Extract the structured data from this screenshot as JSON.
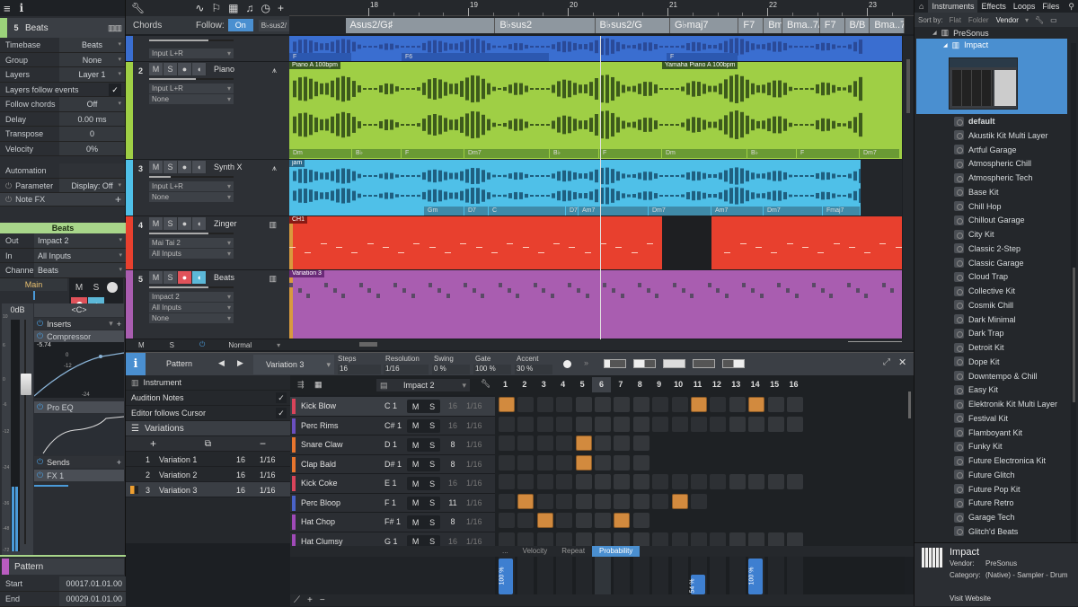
{
  "toolbar": {
    "menu_icon": "hamburger-icon",
    "info_icon": "info-icon",
    "tools": [
      "wrench-icon",
      "automation-icon",
      "marker-icon",
      "grid-icon",
      "note-icon",
      "clock-icon",
      "plus-icon"
    ]
  },
  "inspector": {
    "track_number": "5",
    "track_name": "Beats",
    "params": [
      {
        "label": "Timebase",
        "value": "Beats",
        "dropdown": true
      },
      {
        "label": "Group",
        "value": "None",
        "dropdown": true
      },
      {
        "label": "Layers",
        "value": "Layer 1",
        "dropdown": true
      }
    ],
    "layers_follow_events": {
      "label": "Layers follow events",
      "checked": true
    },
    "params2": [
      {
        "label": "Follow chords",
        "value": "Off",
        "dropdown": true
      },
      {
        "label": "Delay",
        "value": "0.00 ms"
      },
      {
        "label": "Transpose",
        "value": "0"
      },
      {
        "label": "Velocity",
        "value": "0%"
      }
    ],
    "automation_label": "Automation",
    "parameter_label": "Parameter",
    "display_value": "Display: Off",
    "note_fx_label": "Note FX",
    "channel_name": "Beats",
    "routing": [
      {
        "label": "Out",
        "value": "Impact 2"
      },
      {
        "label": "In",
        "value": "All Inputs"
      },
      {
        "label": "Channel",
        "value": "Beats"
      }
    ],
    "main_label": "Main",
    "volume_label": "0dB",
    "pan_label": "<C>",
    "mute_label": "M",
    "solo_label": "S",
    "inserts_label": "Inserts",
    "inserts": [
      "Compressor",
      "Pro EQ"
    ],
    "compressor_value": "-5.74",
    "comp_scale": [
      "0",
      "-12",
      "-24"
    ],
    "meter_scale": [
      "10",
      "6",
      "0",
      "-6",
      "-12",
      "-24",
      "-36",
      "-48",
      "-72"
    ],
    "sends_label": "Sends",
    "sends": [
      "FX 1"
    ],
    "pattern_label": "Pattern",
    "pattern_start_label": "Start",
    "pattern_start": "00017.01.01.00",
    "pattern_end_label": "End",
    "pattern_end": "00029.01.01.00"
  },
  "chord_header": {
    "label": "Chords",
    "follow_label": "Follow:",
    "follow_value": "On",
    "current_chord": "B♭sus2/"
  },
  "ruler": {
    "bars": [
      "18",
      "19",
      "20",
      "21",
      "22",
      "23"
    ]
  },
  "chord_track": [
    {
      "name": "Asus2/G♯",
      "start": 0.09,
      "end": 0.33
    },
    {
      "name": "B♭sus2",
      "start": 0.33,
      "end": 0.49
    },
    {
      "name": "B♭sus2/G",
      "start": 0.49,
      "end": 0.61
    },
    {
      "name": "G♭maj7",
      "start": 0.61,
      "end": 0.72
    },
    {
      "name": "F7",
      "start": 0.72,
      "end": 0.76
    },
    {
      "name": "Bm",
      "start": 0.76,
      "end": 0.79
    },
    {
      "name": "Bma..7/(",
      "start": 0.79,
      "end": 0.85
    },
    {
      "name": "F7",
      "start": 0.85,
      "end": 0.89
    },
    {
      "name": "B/B",
      "start": 0.89,
      "end": 0.93
    },
    {
      "name": "Bma..7",
      "start": 0.93,
      "end": 0.985
    }
  ],
  "tracks": [
    {
      "number": "",
      "name": "",
      "color": "#3a6ed0",
      "input": "Input L+R",
      "chords": [
        "F",
        "F6",
        "F"
      ]
    },
    {
      "number": "2",
      "name": "Piano",
      "color": "#9fcf45",
      "input": "Input L+R",
      "output": "None",
      "clips": [
        "Piano A 100bpm",
        "Yamaha Piano A 100bpm"
      ],
      "chords": [
        "Dm",
        "B♭",
        "F",
        "Dm7",
        "B♭",
        "F",
        "Dm",
        "B♭",
        "F",
        "Dm7"
      ]
    },
    {
      "number": "3",
      "name": "Synth X",
      "color": "#4fc0e8",
      "input": "Input L+R",
      "output": "None",
      "clips": [
        "jam"
      ],
      "chords": [
        "Gm",
        "D7",
        "C",
        "D7",
        "Am7",
        "Dm7",
        "Am7",
        "Dm7",
        "Fmaj7"
      ]
    },
    {
      "number": "4",
      "name": "Zinger",
      "color": "#e8402e",
      "instrument": "Mai Tai 2",
      "input": "All Inputs",
      "clips": [
        "CH1"
      ]
    },
    {
      "number": "5",
      "name": "Beats",
      "color": "#a95db0",
      "instrument": "Impact 2",
      "input": "All Inputs",
      "output": "None",
      "clips": [
        "Variation 3"
      ]
    }
  ],
  "track_footer": {
    "m": "M",
    "s": "S",
    "mode": "Normal"
  },
  "pattern_editor": {
    "pattern_label": "Pattern",
    "variation": "Variation 3",
    "steps_label": "Steps",
    "steps": "16",
    "resolution_label": "Resolution",
    "resolution": "1/16",
    "swing_label": "Swing",
    "swing": "0 %",
    "gate_label": "Gate",
    "gate": "100 %",
    "accent_label": "Accent",
    "accent": "30 %",
    "instrument_label": "Instrument",
    "audition_notes": {
      "label": "Audition Notes",
      "checked": true
    },
    "editor_follows": {
      "label": "Editor follows Cursor",
      "checked": true
    },
    "variations_label": "Variations",
    "variations": [
      {
        "index": "1",
        "name": "Variation 1",
        "steps": "16",
        "res": "1/16"
      },
      {
        "index": "2",
        "name": "Variation 2",
        "steps": "16",
        "res": "1/16"
      },
      {
        "index": "3",
        "name": "Variation 3",
        "steps": "16",
        "res": "1/16",
        "selected": true
      }
    ],
    "instrument_select": "Impact 2",
    "step_numbers": [
      "1",
      "2",
      "3",
      "4",
      "5",
      "6",
      "7",
      "8",
      "9",
      "10",
      "11",
      "12",
      "13",
      "14",
      "15",
      "16"
    ],
    "current_step": 6,
    "instruments": [
      {
        "name": "Kick Blow",
        "pitch": "C 1",
        "steps": "16",
        "res": "1/16",
        "color": "#d9445a",
        "active": [
          1,
          11,
          14
        ]
      },
      {
        "name": "Perc Rims",
        "pitch": "C# 1",
        "steps": "16",
        "res": "1/16",
        "color": "#6a4fc0",
        "active": []
      },
      {
        "name": "Snare Claw",
        "pitch": "D 1",
        "steps": "8",
        "res": "1/16",
        "color": "#e8752e",
        "active": [
          5
        ]
      },
      {
        "name": "Clap Bald",
        "pitch": "D# 1",
        "steps": "8",
        "res": "1/16",
        "color": "#e8752e",
        "active": [
          5
        ]
      },
      {
        "name": "Kick Coke",
        "pitch": "E 1",
        "steps": "16",
        "res": "1/16",
        "color": "#d9445a",
        "active": []
      },
      {
        "name": "Perc Bloop",
        "pitch": "F 1",
        "steps": "11",
        "res": "1/16",
        "color": "#4a63c8",
        "active": [
          2,
          10
        ]
      },
      {
        "name": "Hat Chop",
        "pitch": "F# 1",
        "steps": "8",
        "res": "1/16",
        "color": "#a04ab8",
        "active": [
          3,
          7
        ]
      },
      {
        "name": "Hat Clumsy",
        "pitch": "G 1",
        "steps": "16",
        "res": "1/16",
        "color": "#a04ab8",
        "active": []
      }
    ],
    "ms_m": "M",
    "ms_s": "S",
    "lane_tabs": [
      "...",
      "Velocity",
      "Repeat",
      "Probability"
    ],
    "active_lane_tab": "Probability",
    "probability": [
      {
        "step": 1,
        "value": "100 %"
      },
      {
        "step": 11,
        "value": "54 %"
      },
      {
        "step": 14,
        "value": "100 %"
      }
    ]
  },
  "browser": {
    "tabs": [
      "Instruments",
      "Effects",
      "Loops",
      "Files"
    ],
    "sort_by": "Sort by:",
    "sort_options": [
      "Flat",
      "Folder",
      "Vendor"
    ],
    "active_sort": "Vendor",
    "vendor": "PreSonus",
    "instrument": "Impact",
    "presets": [
      "default",
      "Akustik Kit Multi Layer",
      "Artful Garage",
      "Atmospheric Chill",
      "Atmospheric Tech",
      "Base Kit",
      "Chill Hop",
      "Chillout Garage",
      "City Kit",
      "Classic 2-Step",
      "Classic Garage",
      "Cloud Trap",
      "Collective Kit",
      "Cosmik Chill",
      "Dark Minimal",
      "Dark Trap",
      "Detroit Kit",
      "Dope Kit",
      "Downtempo & Chill",
      "Easy Kit",
      "Elektronik Kit Multi Layer",
      "Festival Kit",
      "Flamboyant Kit",
      "Funky Kit",
      "Future Electronica Kit",
      "Future Glitch",
      "Future Pop Kit",
      "Future Retro",
      "Garage Tech",
      "Glitch'd Beats"
    ],
    "info_name": "Impact",
    "vendor_label": "Vendor:",
    "vendor_value": "PreSonus",
    "category_label": "Category:",
    "category_value": "(Native) - Sampler - Drum",
    "visit_website": "Visit Website"
  }
}
